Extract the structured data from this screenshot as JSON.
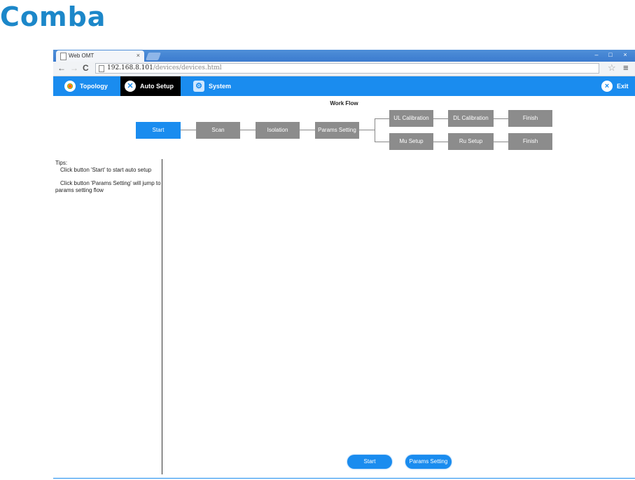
{
  "logo": {
    "text": "Comba"
  },
  "browser": {
    "tab_title": "Web OMT",
    "tab_close": "×",
    "url_host": "192.168.8.101",
    "url_path": "/devices/devices.html",
    "window_controls": {
      "min": "–",
      "max": "□",
      "close": "×"
    },
    "nav": {
      "back": "←",
      "forward": "→",
      "reload": "C",
      "star": "☆",
      "menu": "≡"
    }
  },
  "appnav": {
    "items": [
      {
        "label": "Topology",
        "icon": "topology-icon"
      },
      {
        "label": "Auto Setup",
        "icon": "wrench-icon",
        "active": true
      },
      {
        "label": "System",
        "icon": "system-gear-icon"
      }
    ],
    "exit_label": "Exit",
    "active_color": "#000000",
    "bar_color": "#1a8cef"
  },
  "workflow": {
    "title": "Work Flow",
    "stages": {
      "start": "Start",
      "scan": "Scan",
      "isolation": "Isolation",
      "params": "Params Setting",
      "ul_cal": "UL Calibration",
      "dl_cal": "DL Calibration",
      "finish1": "Finish",
      "mu": "Mu Setup",
      "ru": "Ru Setup",
      "finish2": "Finish"
    },
    "active_stage": "Start"
  },
  "tips": {
    "heading": "Tips:",
    "line1": "Click button 'Start' to start auto setup",
    "line2": "Click button 'Params Setting' will jump to params setting flow"
  },
  "buttons": {
    "start": "Start",
    "params": "Params Setting"
  }
}
